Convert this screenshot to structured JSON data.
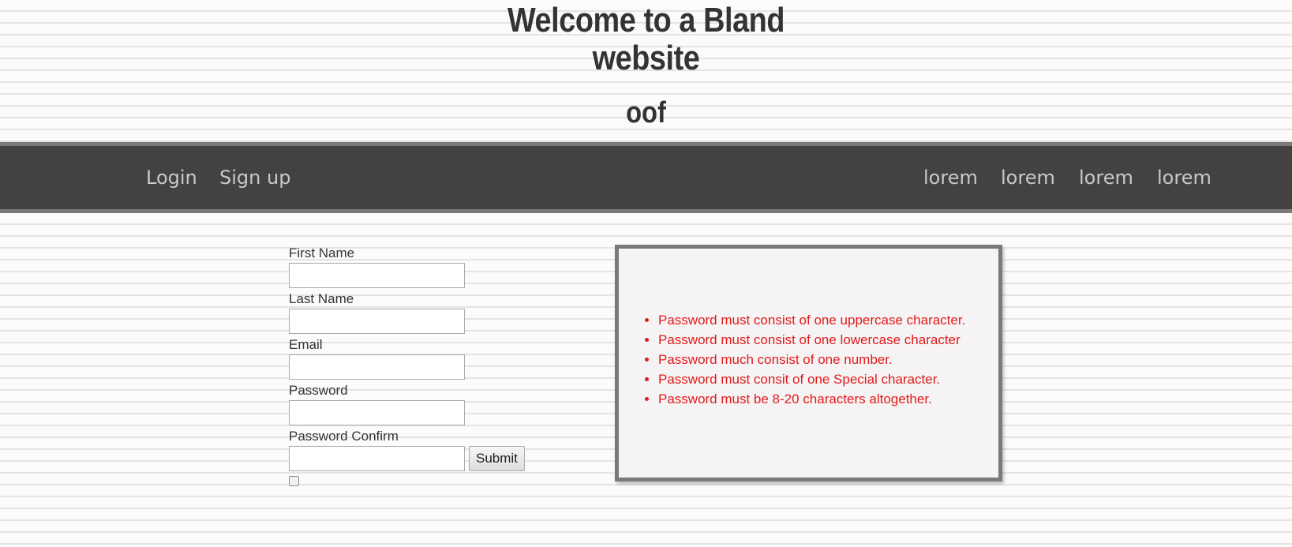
{
  "header": {
    "title_line1": "Welcome to a Bland",
    "title_line2": "website",
    "subtitle": "oof"
  },
  "nav": {
    "left": [
      "Login",
      "Sign up"
    ],
    "right": [
      "lorem",
      "lorem",
      "lorem",
      "lorem"
    ]
  },
  "form": {
    "fields": [
      {
        "label": "First Name",
        "value": ""
      },
      {
        "label": "Last Name",
        "value": ""
      },
      {
        "label": "Email",
        "value": ""
      },
      {
        "label": "Password",
        "value": ""
      },
      {
        "label": "Password Confirm",
        "value": ""
      }
    ],
    "submit_label": "Submit",
    "checkbox_checked": false
  },
  "requirements": [
    "Password must consist of one uppercase character.",
    "Password must consist of one lowercase character",
    "Password much consist of one number.",
    "Password must consit of one Special character.",
    "Password must be 8-20 characters altogether."
  ],
  "colors": {
    "navbar_bg": "#424242",
    "navbar_border": "#7a7a7a",
    "nav_text": "#c8c8c8",
    "requirement_text": "#e11b1b",
    "box_bg": "#f6f3f4"
  }
}
